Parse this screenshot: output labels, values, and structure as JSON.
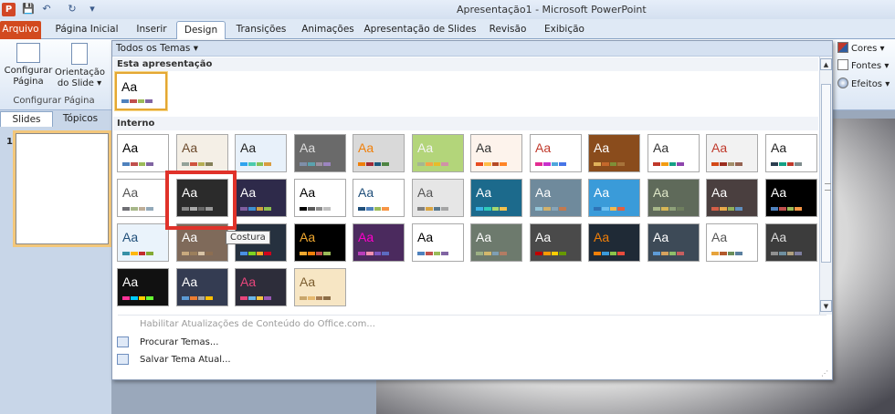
{
  "titlebar": {
    "app_icon": "P",
    "title": "Apresentação1 - Microsoft PowerPoint",
    "qa": [
      "💾",
      "↶",
      "↻",
      "▾"
    ]
  },
  "tabs": [
    "Arquivo",
    "Página Inicial",
    "Inserir",
    "Design",
    "Transições",
    "Animações",
    "Apresentação de Slides",
    "Revisão",
    "Exibição"
  ],
  "ribbon": {
    "configurar": "Configurar\nPágina",
    "orientacao": "Orientação\ndo Slide ▾",
    "group_label": "Configurar Página",
    "cores": "Cores ▾",
    "fontes": "Fontes ▾",
    "efeitos": "Efeitos ▾"
  },
  "pane": {
    "tab_slides": "Slides",
    "tab_topicos": "Tópicos",
    "slide_num": "1"
  },
  "dropdown": {
    "filter": "Todos os Temas ▾",
    "sec_current": "Esta apresentação",
    "sec_builtin": "Interno",
    "tooltip": "Costura",
    "menu": [
      "Habilitar Atualizações de Conteúdo do Office.com...",
      "Procurar Temas...",
      "Salvar Tema Atual..."
    ],
    "thumb_text": "Aa",
    "themes": [
      {
        "bg": "#ffffff",
        "fg": "#000",
        "bars": [
          "#4f81bd",
          "#c0504d",
          "#9bbb59",
          "#8064a2"
        ]
      },
      {
        "bg": "#f4efe6",
        "fg": "#6b4a2c",
        "bars": [
          "#93a299",
          "#cf543f",
          "#b5ae53",
          "#848058"
        ]
      },
      {
        "bg": "#e8f1fa",
        "fg": "#222",
        "bars": [
          "#2fa3ee",
          "#4bcaad",
          "#86c157",
          "#d99c3f"
        ]
      },
      {
        "bg": "#6a6a6a",
        "fg": "#ddd",
        "bars": [
          "#7f8fa9",
          "#5aa2ae",
          "#9d90a0",
          "#9c85c0"
        ]
      },
      {
        "bg": "#d9d9d9",
        "fg": "#f07f09",
        "bars": [
          "#f07f09",
          "#9f2936",
          "#1b587c",
          "#4e8542"
        ]
      },
      {
        "bg": "#b3d57a",
        "fg": "#f5f5f5",
        "bars": [
          "#a5b592",
          "#f3a447",
          "#e7bc29",
          "#d092a7"
        ]
      },
      {
        "bg": "#fdf3ec",
        "fg": "#333",
        "bars": [
          "#e84c22",
          "#ffbd47",
          "#b64926",
          "#ff8427"
        ]
      },
      {
        "bg": "#ffffff",
        "fg": "#c0392b",
        "bars": [
          "#e32d91",
          "#c830cc",
          "#4ea6dc",
          "#4775e7"
        ]
      },
      {
        "bg": "#8a4c1c",
        "fg": "#fff",
        "bars": [
          "#e0b15a",
          "#c5682b",
          "#7f8f37",
          "#a7733a"
        ]
      },
      {
        "bg": "#ffffff",
        "fg": "#333",
        "bars": [
          "#c0392b",
          "#f39c12",
          "#16a085",
          "#8e44ad"
        ]
      },
      {
        "bg": "#f2f2f2",
        "fg": "#c0392b",
        "bars": [
          "#d34817",
          "#9b2d1f",
          "#a28e6a",
          "#956251"
        ]
      },
      {
        "bg": "#ffffff",
        "fg": "#222",
        "bars": [
          "#2c3e50",
          "#16a085",
          "#c0392b",
          "#7f8c8d"
        ]
      },
      {
        "bg": "#ffffff",
        "fg": "#555",
        "bars": [
          "#6f6f74",
          "#a7b789",
          "#beae98",
          "#92a9b9"
        ]
      },
      {
        "bg": "#2b2b2b",
        "fg": "#fff",
        "bars": [
          "#888",
          "#aaa",
          "#666",
          "#999"
        ]
      },
      {
        "bg": "#2e2a4a",
        "fg": "#fff",
        "bars": [
          "#7f5fa0",
          "#3f8fcf",
          "#cfa03f",
          "#8fbf4f"
        ]
      },
      {
        "bg": "#ffffff",
        "fg": "#000",
        "bars": [
          "#000000",
          "#595959",
          "#8c8c8c",
          "#bfbfbf"
        ]
      },
      {
        "bg": "#ffffff",
        "fg": "#1f4e79",
        "bars": [
          "#1f4e79",
          "#4f81bd",
          "#9bbb59",
          "#f79646"
        ]
      },
      {
        "bg": "#e6e6e6",
        "fg": "#555",
        "bars": [
          "#7f7f7f",
          "#d9a441",
          "#59788e",
          "#a5a5a5"
        ]
      },
      {
        "bg": "#1c6a8c",
        "fg": "#fff",
        "bars": [
          "#3cb3e6",
          "#2fcbb8",
          "#a5d86e",
          "#f2c14e"
        ]
      },
      {
        "bg": "#6f8a9c",
        "fg": "#fff",
        "bars": [
          "#94c5d8",
          "#d0b06b",
          "#87a4b8",
          "#c27a4f"
        ]
      },
      {
        "bg": "#3a9bd9",
        "fg": "#fff",
        "bars": [
          "#2f73b6",
          "#6cbff0",
          "#f2b84e",
          "#e35f3f"
        ]
      },
      {
        "bg": "#5f6a5a",
        "fg": "#dfe7c8",
        "bars": [
          "#a7b789",
          "#d6b656",
          "#8ea17a",
          "#6f7f5f"
        ]
      },
      {
        "bg": "#4a3f3f",
        "fg": "#fff",
        "bars": [
          "#d45f48",
          "#e8a94a",
          "#8fae5a",
          "#5f8fbf"
        ]
      },
      {
        "bg": "#000000",
        "fg": "#fff",
        "bars": [
          "#4f81bd",
          "#c0504d",
          "#9bbb59",
          "#f79646"
        ]
      },
      {
        "bg": "#eaf3fb",
        "fg": "#1f4e79",
        "bars": [
          "#3891a7",
          "#feb80a",
          "#c32d2e",
          "#84aa33"
        ]
      },
      {
        "bg": "#7f6a5a",
        "fg": "#fff",
        "bars": [
          "#c8a97e",
          "#9b7f5c",
          "#d8c3a5",
          "#8c6e52"
        ]
      },
      {
        "bg": "#26313f",
        "fg": "#fff",
        "bars": [
          "#4a90e2",
          "#7ed321",
          "#f5a623",
          "#d0021b"
        ]
      },
      {
        "bg": "#000000",
        "fg": "#f0a830",
        "bars": [
          "#f0a830",
          "#f07f09",
          "#c0504d",
          "#9bbb59"
        ]
      },
      {
        "bg": "#4b2a5e",
        "fg": "#f0c",
        "bars": [
          "#b83dba",
          "#f48fb1",
          "#7e57c2",
          "#5c6bc0"
        ]
      },
      {
        "bg": "#ffffff",
        "fg": "#000",
        "bars": [
          "#4f81bd",
          "#c0504d",
          "#9bbb59",
          "#8064a2"
        ]
      },
      {
        "bg": "#6d7a6d",
        "fg": "#fff",
        "bars": [
          "#9cb084",
          "#d3b86c",
          "#7f9fb3",
          "#b27c64"
        ]
      },
      {
        "bg": "#4a4a4a",
        "fg": "#fff",
        "bars": [
          "#c00000",
          "#ff9900",
          "#ffcc00",
          "#669900"
        ]
      },
      {
        "bg": "#1f2a36",
        "fg": "#f07f09",
        "bars": [
          "#f07f09",
          "#3b9ad9",
          "#8bc34a",
          "#e84c3d"
        ]
      },
      {
        "bg": "#3d4a57",
        "fg": "#fff",
        "bars": [
          "#5e9bd6",
          "#d6a25e",
          "#8fbf6a",
          "#c75f5f"
        ]
      },
      {
        "bg": "#ffffff",
        "fg": "#555",
        "bars": [
          "#e7a33b",
          "#b35a2c",
          "#6b8e5a",
          "#5a7f9e"
        ]
      },
      {
        "bg": "#3c3c3c",
        "fg": "#ddd",
        "bars": [
          "#909090",
          "#6f8f9f",
          "#b0a080",
          "#7f7f9f"
        ]
      },
      {
        "bg": "#111111",
        "fg": "#fff",
        "bars": [
          "#ff3399",
          "#00ccff",
          "#ffcc00",
          "#66ff33"
        ]
      },
      {
        "bg": "#343c52",
        "fg": "#fff",
        "bars": [
          "#5b9bd5",
          "#ed7d31",
          "#a5a5a5",
          "#ffc000"
        ]
      },
      {
        "bg": "#2d2d3a",
        "fg": "#e8467c",
        "bars": [
          "#e8467c",
          "#6bb5e8",
          "#f5c542",
          "#9b59b6"
        ]
      },
      {
        "bg": "#f7e6c4",
        "fg": "#7a5c2e",
        "bars": [
          "#c9a66b",
          "#e6b96f",
          "#a67c52",
          "#8c6d46"
        ]
      }
    ]
  }
}
